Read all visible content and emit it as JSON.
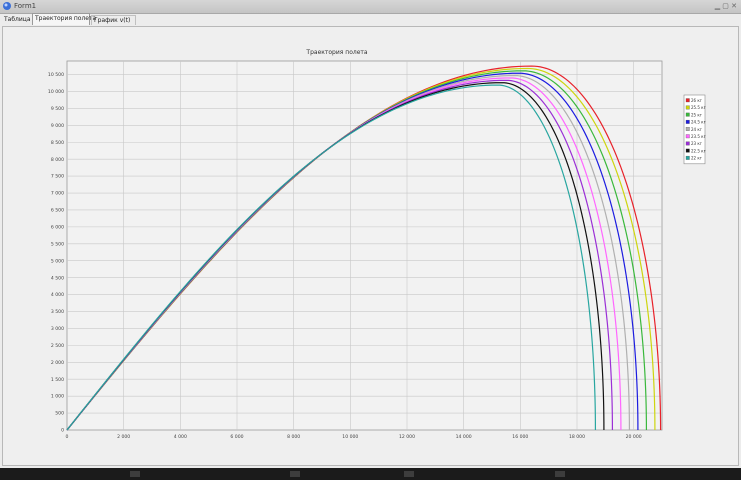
{
  "window": {
    "title": "Form1"
  },
  "tabs": [
    {
      "label": "Таблица"
    },
    {
      "label": "Траектория полета"
    },
    {
      "label": "График v(t)"
    }
  ],
  "colors": {
    "plot_bg": "#f2f2f2",
    "grid": "#c8c8c8"
  },
  "chart_data": {
    "type": "line",
    "title": "Траектория полета",
    "xlabel": "",
    "ylabel": "",
    "xlim": [
      0,
      21000
    ],
    "ylim": [
      0,
      10900
    ],
    "x_ticks": [
      0,
      2000,
      4000,
      6000,
      8000,
      10000,
      12000,
      14000,
      16000,
      18000,
      20000
    ],
    "x_tick_labels": [
      "0",
      "2 000",
      "4 000",
      "6 000",
      "8 000",
      "10 000",
      "12 000",
      "14 000",
      "16 000",
      "18 000",
      "20 000"
    ],
    "y_ticks": [
      0,
      500,
      1000,
      1500,
      2000,
      2500,
      3000,
      3500,
      4000,
      4500,
      5000,
      5500,
      6000,
      6500,
      7000,
      7500,
      8000,
      8500,
      9000,
      9500,
      10000,
      10500
    ],
    "y_tick_labels": [
      "0",
      "500",
      "1 000",
      "1 500",
      "2 000",
      "2 500",
      "3 000",
      "3 500",
      "4 000",
      "4 500",
      "5 000",
      "5 500",
      "6 000",
      "6 500",
      "7 000",
      "7 500",
      "8 000",
      "8 500",
      "9 000",
      "9 500",
      "10 000",
      "10 500"
    ],
    "grid": true,
    "legend_position": "top-right",
    "series": [
      {
        "name": "26 кг",
        "color": "#e8222a",
        "x_peak": 16400,
        "y_peak": 10750,
        "x_end": 20950
      },
      {
        "name": "25.5 кг",
        "color": "#cdd50e",
        "x_peak": 16250,
        "y_peak": 10680,
        "x_end": 20750
      },
      {
        "name": "25 кг",
        "color": "#3ab83c",
        "x_peak": 16100,
        "y_peak": 10610,
        "x_end": 20450
      },
      {
        "name": "24.5 кг",
        "color": "#1c1ce0",
        "x_peak": 15950,
        "y_peak": 10540,
        "x_end": 20150
      },
      {
        "name": "24 кг",
        "color": "#b0b0b0",
        "x_peak": 15800,
        "y_peak": 10470,
        "x_end": 19850
      },
      {
        "name": "23.5 кг",
        "color": "#ff66ff",
        "x_peak": 15650,
        "y_peak": 10400,
        "x_end": 19550
      },
      {
        "name": "23 кг",
        "color": "#9b2fd6",
        "x_peak": 15500,
        "y_peak": 10330,
        "x_end": 19250
      },
      {
        "name": "22.5 кг",
        "color": "#111111",
        "x_peak": 15350,
        "y_peak": 10260,
        "x_end": 18950
      },
      {
        "name": "22 кг",
        "color": "#28a6a0",
        "x_peak": 15200,
        "y_peak": 10190,
        "x_end": 18650
      }
    ]
  }
}
